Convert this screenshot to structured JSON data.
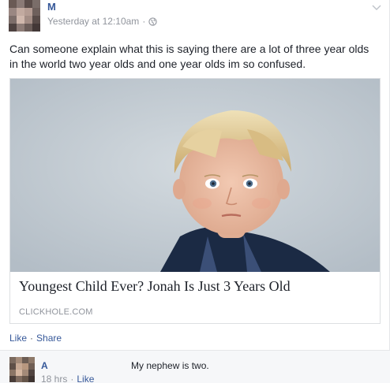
{
  "post": {
    "author": "M",
    "timestamp": "Yesterday at 12:10am",
    "separator": "·",
    "privacy_icon": "globe-icon",
    "menu_icon": "chevron-down-icon",
    "text": "Can someone explain what this is saying there are a lot of three year olds in the world two year olds and one year olds im so confused."
  },
  "link_card": {
    "image_icon": "child-photo",
    "title": "Youngest Child Ever? Jonah Is Just 3 Years Old",
    "domain": "CLICKHOLE.COM"
  },
  "actions": {
    "like": "Like",
    "separator": "·",
    "share": "Share"
  },
  "comments": [
    {
      "author": "A",
      "text": "My nephew is two.",
      "time": "18 hrs",
      "separator": "·",
      "like": "Like"
    }
  ],
  "colors": {
    "link": "#365899",
    "meta": "#90949c",
    "text": "#1d2129",
    "comment_bg": "#f6f7f9"
  }
}
